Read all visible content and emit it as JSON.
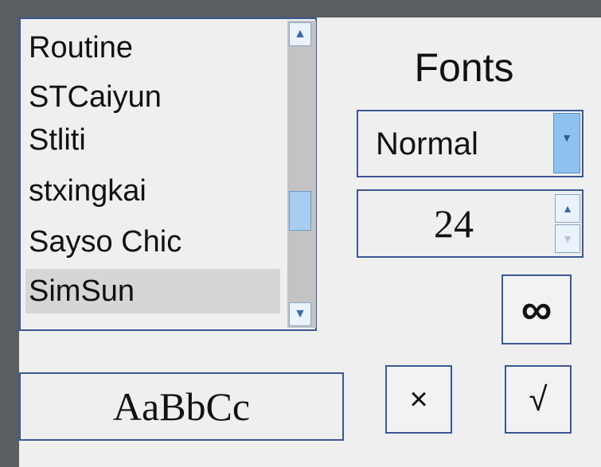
{
  "font_list": {
    "items": [
      {
        "label": "Routine",
        "selected": false
      },
      {
        "label": "STCaiyun",
        "selected": false
      },
      {
        "label": "Stliti",
        "selected": false
      },
      {
        "label": "stxingkai",
        "selected": false
      },
      {
        "label": "Sayso Chic",
        "selected": false
      },
      {
        "label": "SimSun",
        "selected": true
      }
    ]
  },
  "title": "Fonts",
  "style_select": {
    "value": "Normal"
  },
  "size_stepper": {
    "value": "24"
  },
  "link_button": {
    "label": "∞"
  },
  "preview": {
    "text": "AaBbCc"
  },
  "cancel_button": {
    "label": "×"
  },
  "ok_button": {
    "label": "√"
  },
  "colors": {
    "accent": "#3b5794",
    "selection": "#d6d6d6",
    "scroll_thumb": "#a9cdf0"
  }
}
